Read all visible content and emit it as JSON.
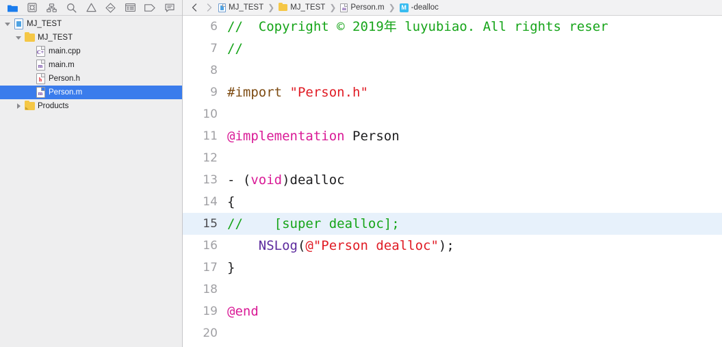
{
  "navigator": {
    "toolbar": [
      {
        "name": "project-navigator-icon",
        "glyph": "folder",
        "active": true
      },
      {
        "name": "source-control-navigator-icon",
        "glyph": "source-control",
        "active": false
      },
      {
        "name": "symbol-navigator-icon",
        "glyph": "hierarchy",
        "active": false
      },
      {
        "name": "find-navigator-icon",
        "glyph": "search",
        "active": false
      },
      {
        "name": "issue-navigator-icon",
        "glyph": "warning",
        "active": false
      },
      {
        "name": "test-navigator-icon",
        "glyph": "diamond",
        "active": false
      },
      {
        "name": "debug-navigator-icon",
        "glyph": "list",
        "active": false
      },
      {
        "name": "breakpoint-navigator-icon",
        "glyph": "tag",
        "active": false
      },
      {
        "name": "report-navigator-icon",
        "glyph": "speech",
        "active": false
      }
    ],
    "tree": [
      {
        "label": "MJ_TEST",
        "icon": "project-document-icon",
        "icon_kind": "project",
        "depth": 0,
        "twisty": "open",
        "selected": false
      },
      {
        "label": "MJ_TEST",
        "icon": "folder-icon",
        "icon_kind": "folder",
        "depth": 1,
        "twisty": "open",
        "selected": false
      },
      {
        "label": "main.cpp",
        "icon": "cpp-file-icon",
        "icon_kind": "doc",
        "badge": "C+",
        "badge_color": "#6b3fa0",
        "depth": 2,
        "twisty": "none",
        "selected": false
      },
      {
        "label": "main.m",
        "icon": "objc-file-icon",
        "icon_kind": "doc",
        "badge": "m",
        "badge_color": "#6b3fa0",
        "depth": 2,
        "twisty": "none",
        "selected": false
      },
      {
        "label": "Person.h",
        "icon": "header-file-icon",
        "icon_kind": "doc",
        "badge": "h",
        "badge_color": "#e01b24",
        "depth": 2,
        "twisty": "none",
        "selected": false
      },
      {
        "label": "Person.m",
        "icon": "objc-file-icon",
        "icon_kind": "doc",
        "badge": "m",
        "badge_color": "#6b3fa0",
        "depth": 2,
        "twisty": "none",
        "selected": true
      },
      {
        "label": "Products",
        "icon": "products-folder-icon",
        "icon_kind": "folder-products",
        "depth": 1,
        "twisty": "closed",
        "selected": false
      }
    ],
    "selection_color": "#3a7cec"
  },
  "breadcrumb": {
    "back_label": "‹",
    "forward_label": "›",
    "items": [
      {
        "label": "MJ_TEST",
        "icon": "project-document-icon",
        "icon_kind": "project"
      },
      {
        "label": "MJ_TEST",
        "icon": "folder-icon",
        "icon_kind": "folder"
      },
      {
        "label": "Person.m",
        "icon": "objc-file-icon",
        "icon_kind": "doc",
        "badge": "m",
        "badge_color": "#6b3fa0"
      },
      {
        "label": "-dealloc",
        "icon": "method-badge-icon",
        "icon_kind": "method",
        "badge": "M"
      }
    ],
    "separator": "❯"
  },
  "editor": {
    "current_line": 15,
    "current_line_color": "#e7f1fb",
    "lines": [
      {
        "n": 6,
        "tokens": [
          {
            "t": "//  Copyright © 2019年 luyubiao. All rights reser",
            "c": "comment"
          }
        ]
      },
      {
        "n": 7,
        "tokens": [
          {
            "t": "//",
            "c": "comment"
          }
        ]
      },
      {
        "n": 8,
        "tokens": [
          {
            "t": "",
            "c": "plain"
          }
        ]
      },
      {
        "n": 9,
        "tokens": [
          {
            "t": "#import ",
            "c": "pre"
          },
          {
            "t": "\"Person.h\"",
            "c": "string"
          }
        ]
      },
      {
        "n": 10,
        "tokens": [
          {
            "t": "",
            "c": "plain"
          }
        ]
      },
      {
        "n": 11,
        "tokens": [
          {
            "t": "@implementation",
            "c": "keyword"
          },
          {
            "t": " Person",
            "c": "plain"
          }
        ]
      },
      {
        "n": 12,
        "tokens": [
          {
            "t": "",
            "c": "plain"
          }
        ]
      },
      {
        "n": 13,
        "tokens": [
          {
            "t": "- (",
            "c": "plain"
          },
          {
            "t": "void",
            "c": "keyword"
          },
          {
            "t": ")dealloc",
            "c": "plain"
          }
        ]
      },
      {
        "n": 14,
        "tokens": [
          {
            "t": "{",
            "c": "plain"
          }
        ]
      },
      {
        "n": 15,
        "tokens": [
          {
            "t": "//    [super dealloc];",
            "c": "comment"
          }
        ]
      },
      {
        "n": 16,
        "tokens": [
          {
            "t": "    ",
            "c": "plain"
          },
          {
            "t": "NSLog",
            "c": "func"
          },
          {
            "t": "(",
            "c": "plain"
          },
          {
            "t": "@\"Person dealloc\"",
            "c": "string"
          },
          {
            "t": ");",
            "c": "plain"
          }
        ]
      },
      {
        "n": 17,
        "tokens": [
          {
            "t": "}",
            "c": "plain"
          }
        ]
      },
      {
        "n": 18,
        "tokens": [
          {
            "t": "",
            "c": "plain"
          }
        ]
      },
      {
        "n": 19,
        "tokens": [
          {
            "t": "@end",
            "c": "keyword"
          }
        ]
      },
      {
        "n": 20,
        "tokens": [
          {
            "t": "",
            "c": "plain"
          }
        ]
      }
    ],
    "colors": {
      "comment": "#15a418",
      "preprocessor": "#7d4b12",
      "string": "#e01b24",
      "keyword": "#d91a96",
      "function": "#5c2a9d",
      "plain": "#1d1d1f",
      "line_number": "#a0a0a4"
    }
  }
}
